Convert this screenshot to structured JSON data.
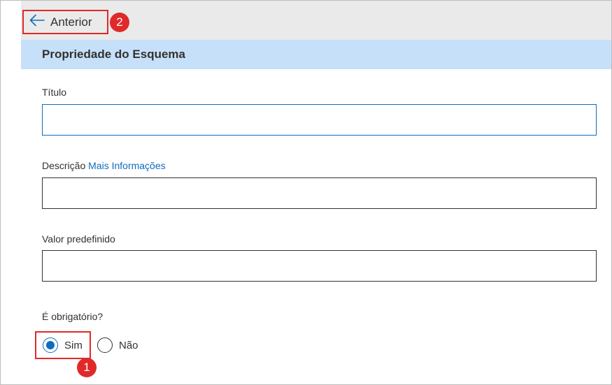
{
  "back": {
    "label": "Anterior"
  },
  "annotations": {
    "badge_back": "2",
    "badge_radio": "1"
  },
  "section": {
    "title": "Propriedade do Esquema"
  },
  "fields": {
    "title": {
      "label": "Título",
      "value": ""
    },
    "description": {
      "label": "Descrição",
      "link": "Mais Informações",
      "value": ""
    },
    "default_value": {
      "label": "Valor predefinido",
      "value": ""
    }
  },
  "required": {
    "question": "É obrigatório?",
    "options": [
      {
        "label": "Sim",
        "checked": true
      },
      {
        "label": "Não",
        "checked": false
      }
    ]
  },
  "colors": {
    "accent": "#0f6cbd",
    "highlight": "#e02a2a",
    "header_bg": "#c7e0f9",
    "topbar_bg": "#eaeaea"
  },
  "icons": {
    "back": "arrow-left-icon"
  }
}
